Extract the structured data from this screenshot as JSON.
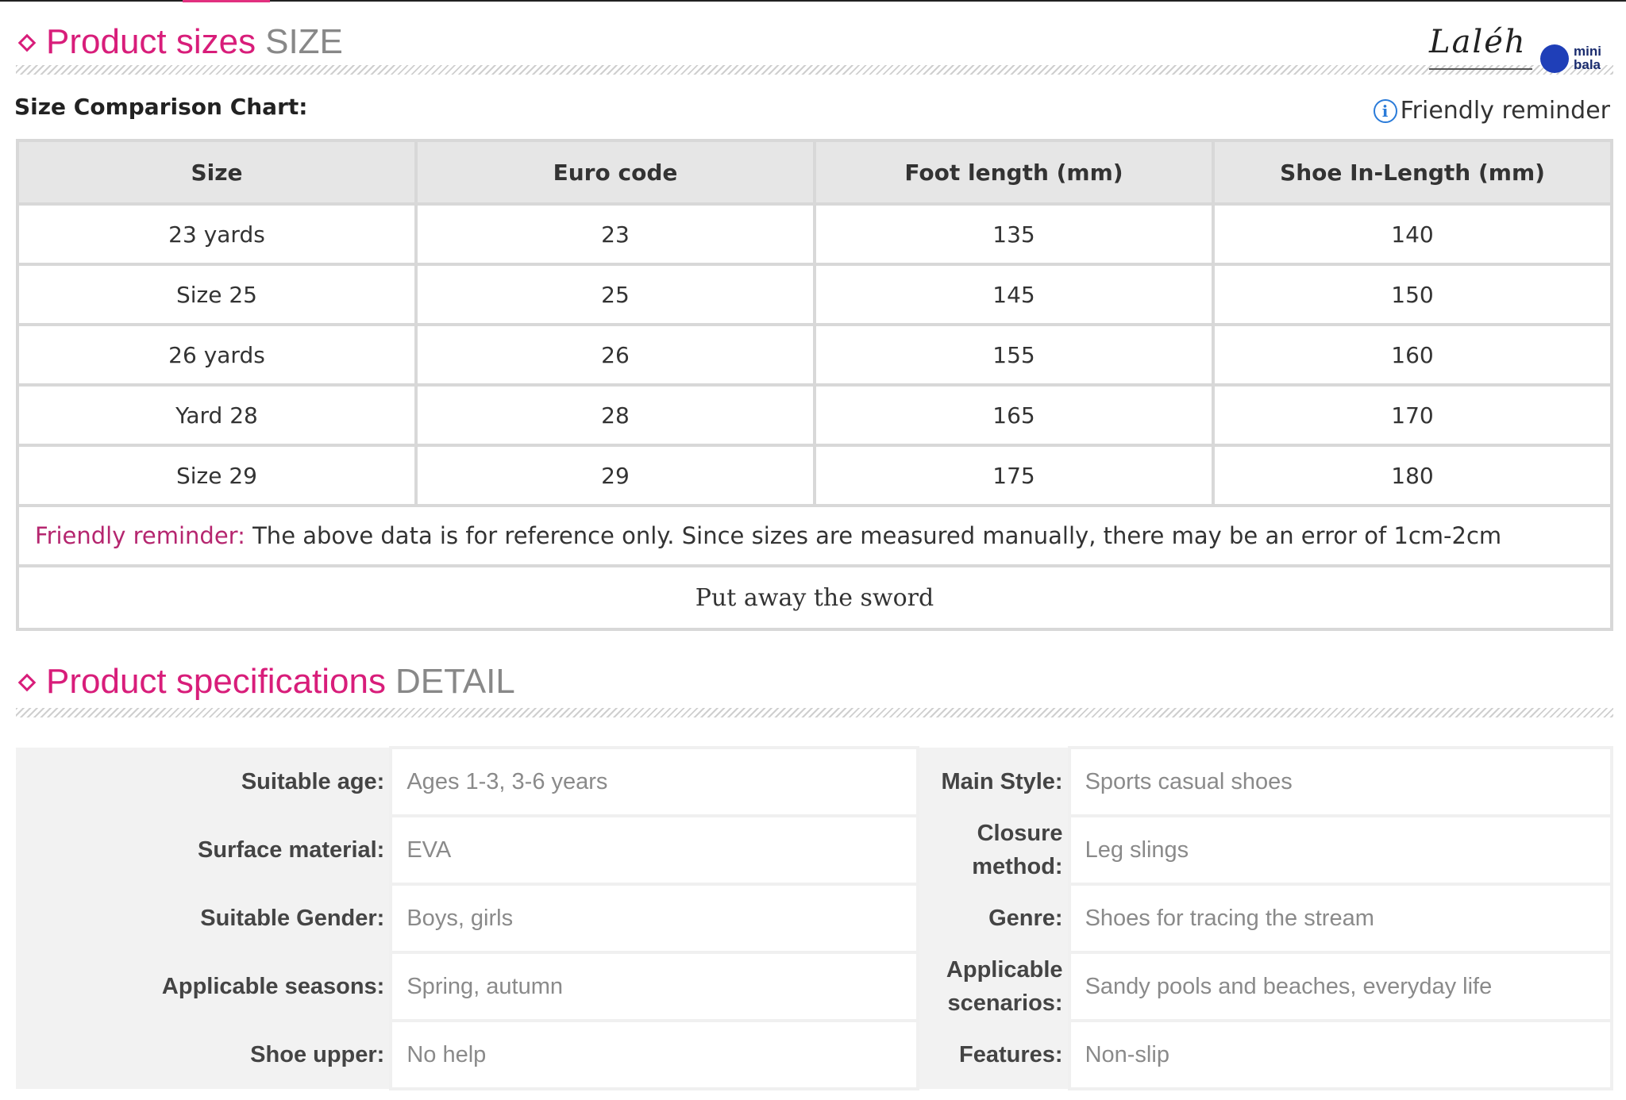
{
  "size_section": {
    "title": "Product sizes",
    "title_en": "SIZE"
  },
  "logo": {
    "script": "Laléh",
    "badge_line1": "mini",
    "badge_line2": "bala"
  },
  "size_chart": {
    "label": "Size Comparison Chart:",
    "reminder_link": "Friendly reminder",
    "columns": [
      "Size",
      "Euro code",
      "Foot length (mm)",
      "Shoe In-Length (mm)"
    ],
    "rows": [
      [
        "23 yards",
        "23",
        "135",
        "140"
      ],
      [
        "Size 25",
        "25",
        "145",
        "150"
      ],
      [
        "26 yards",
        "26",
        "155",
        "160"
      ],
      [
        "Yard 28",
        "28",
        "165",
        "170"
      ],
      [
        "Size 29",
        "29",
        "175",
        "180"
      ]
    ],
    "note_label": "Friendly reminder:",
    "note_text": " The above data is for reference only. Since sizes are measured manually, there may be an error of 1cm-2cm",
    "brand_line": "Put away the sword"
  },
  "spec_section": {
    "title": "Product specifications",
    "title_en": "DETAIL"
  },
  "specs": [
    {
      "l_label": "Suitable age:",
      "l_value": "Ages 1-3, 3-6 years",
      "r_label": "Main Style:",
      "r_value": "Sports casual shoes"
    },
    {
      "l_label": "Surface material:",
      "l_value": "EVA",
      "r_label": "Closure method:",
      "r_value": "Leg slings"
    },
    {
      "l_label": "Suitable Gender:",
      "l_value": "Boys, girls",
      "r_label": "Genre:",
      "r_value": "Shoes for tracing the stream"
    },
    {
      "l_label": "Applicable seasons:",
      "l_value": "Spring, autumn",
      "r_label": "Applicable scenarios:",
      "r_value": "Sandy pools and beaches, everyday life"
    },
    {
      "l_label": "Shoe upper:",
      "l_value": "No help",
      "r_label": "Features:",
      "r_value": "Non-slip"
    }
  ]
}
